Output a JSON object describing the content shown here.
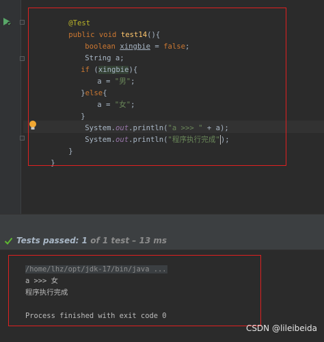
{
  "editor": {
    "lines": [
      {
        "annotation": "@Test"
      },
      {
        "kw": "public void ",
        "method": "test14",
        "rest": "(){"
      },
      {
        "kw": "boolean ",
        "var": "xingbie",
        "mid": " = ",
        "kw2": "false",
        "end": ";"
      },
      {
        "text": "String a;"
      },
      {
        "kw": "if ",
        "open": "(",
        "var": "xingbie",
        "close": "){"
      },
      {
        "text": "a = ",
        "str": "\"男\"",
        "end": ";"
      },
      {
        "brace": "}",
        "kw": "else",
        "rest": "{"
      },
      {
        "text": "a = ",
        "str": "\"女\"",
        "end": ";"
      },
      {
        "text": "}"
      },
      {
        "pre": "System.",
        "field": "out",
        "mid": ".println(",
        "str": "\"a >>> \"",
        "end": " + a);"
      },
      {
        "pre": "System.",
        "field": "out",
        "mid": ".println(",
        "str": "\"程序执行完成\"",
        "end": ");"
      },
      {
        "text": "}"
      },
      {
        "text": "}"
      }
    ]
  },
  "status": {
    "passed_label": "Tests passed: ",
    "passed_count": "1",
    "of_text": " of 1 test",
    "sep": " – ",
    "duration": "13 ms"
  },
  "console": {
    "command": "/home/lhz/opt/jdk-17/bin/java ...",
    "output_1": "a >>> 女",
    "output_2": "程序执行完成",
    "exit": "Process finished with exit code 0"
  },
  "watermark": "CSDN @lileibeida",
  "icons": {
    "run": "run-test-icon",
    "bulb": "intention-bulb-icon",
    "check": "check-icon"
  },
  "colors": {
    "highlight_box": "#e02020",
    "keyword": "#cc7832",
    "string": "#6a8759",
    "passed_check": "#5fb832"
  }
}
